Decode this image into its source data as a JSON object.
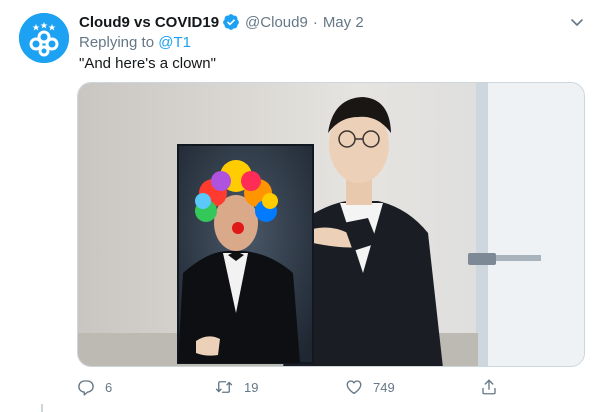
{
  "tweet": {
    "author_name": "Cloud9 vs COVID19",
    "handle": "@Cloud9",
    "separator": "·",
    "date": "May 2",
    "replying_prefix": "Replying to",
    "replying_handle": "@T1",
    "text": "\"And here's a clown\"",
    "counts": {
      "replies": "6",
      "retweets": "19",
      "likes": "749"
    }
  },
  "icons": {
    "avatar": "cloud9-logo",
    "verified": "verified-badge-icon",
    "more": "chevron-down-icon",
    "reply": "reply-icon",
    "retweet": "retweet-icon",
    "like": "heart-icon",
    "share": "share-icon"
  },
  "colors": {
    "accent": "#1da1f2",
    "muted": "#657786",
    "text": "#14171a"
  }
}
